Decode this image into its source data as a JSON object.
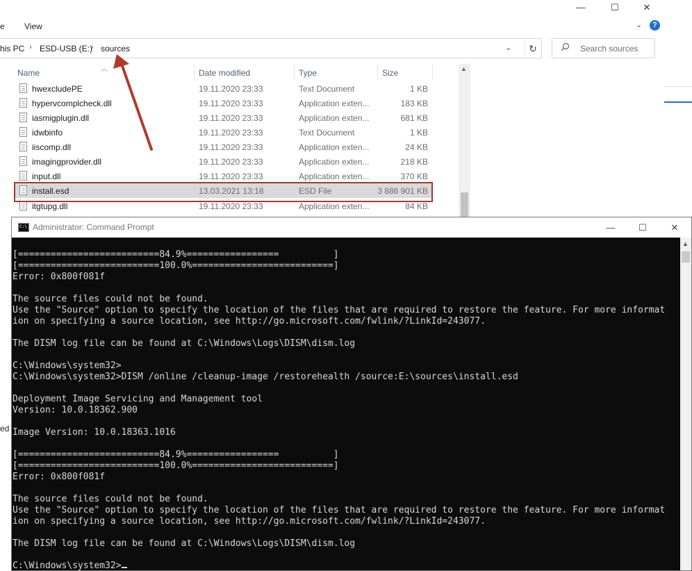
{
  "explorer": {
    "window_controls": {
      "minimize": "—",
      "maximize": "☐",
      "close": "✕"
    },
    "ribbon": {
      "left_tab_fragment": "e",
      "view_tab": "View",
      "expand_glyph": "⌄",
      "help_glyph": "?"
    },
    "address": {
      "crumbs": [
        "his PC",
        "ESD-USB (E:)",
        "sources"
      ],
      "separator": "›",
      "dropdown_glyph": "⌄",
      "refresh_glyph": "↻"
    },
    "search": {
      "placeholder": "Search sources",
      "icon": "search-icon"
    },
    "columns": {
      "name": "Name",
      "date": "Date modified",
      "type": "Type",
      "size": "Size"
    },
    "files": [
      {
        "name": "hwexcludePE",
        "date": "19.11.2020 23:33",
        "type": "Text Document",
        "size": "1 KB"
      },
      {
        "name": "hypervcomplcheck.dll",
        "date": "19.11.2020 23:33",
        "type": "Application exten...",
        "size": "183 KB"
      },
      {
        "name": "iasmigplugin.dll",
        "date": "19.11.2020 23:33",
        "type": "Application exten...",
        "size": "681 KB"
      },
      {
        "name": "idwbinfo",
        "date": "19.11.2020 23:33",
        "type": "Text Document",
        "size": "1 KB"
      },
      {
        "name": "iiscomp.dll",
        "date": "19.11.2020 23:33",
        "type": "Application exten...",
        "size": "24 KB"
      },
      {
        "name": "imagingprovider.dll",
        "date": "19.11.2020 23:33",
        "type": "Application exten...",
        "size": "218 KB"
      },
      {
        "name": "input.dll",
        "date": "19.11.2020 23:33",
        "type": "Application exten...",
        "size": "370 KB"
      },
      {
        "name": "install.esd",
        "date": "13.03.2021 13:18",
        "type": "ESD File",
        "size": "3 886 901 KB"
      },
      {
        "name": "itgtupg.dll",
        "date": "19.11.2020 23:33",
        "type": "Application exten...",
        "size": "84 KB"
      }
    ],
    "left_stub": "ed",
    "colors": {
      "highlight_border": "#a33a2e",
      "arrow": "#b23a2b",
      "accent": "#1c6fd1"
    }
  },
  "cmd": {
    "title": "Administrator: Command Prompt",
    "window_controls": {
      "minimize": "—",
      "maximize": "☐",
      "close": "✕"
    },
    "console_lines": [
      "[==========================84.9%=================          ]",
      "[==========================100.0%==========================]",
      "Error: 0x800f081f",
      "",
      "The source files could not be found.",
      "Use the \"Source\" option to specify the location of the files that are required to restore the feature. For more informat",
      "ion on specifying a source location, see http://go.microsoft.com/fwlink/?LinkId=243077.",
      "",
      "The DISM log file can be found at C:\\Windows\\Logs\\DISM\\dism.log",
      "",
      "C:\\Windows\\system32>",
      "C:\\Windows\\system32>DISM /online /cleanup-image /restorehealth /source:E:\\sources\\install.esd",
      "",
      "Deployment Image Servicing and Management tool",
      "Version: 10.0.18362.900",
      "",
      "Image Version: 10.0.18363.1016",
      "",
      "[==========================84.9%=================          ]",
      "[==========================100.0%==========================]",
      "Error: 0x800f081f",
      "",
      "The source files could not be found.",
      "Use the \"Source\" option to specify the location of the files that are required to restore the feature. For more informat",
      "ion on specifying a source location, see http://go.microsoft.com/fwlink/?LinkId=243077.",
      "",
      "The DISM log file can be found at C:\\Windows\\Logs\\DISM\\dism.log",
      "",
      "C:\\Windows\\system32>"
    ],
    "colors": {
      "background": "#0c0c0c",
      "text": "#d8d8d8"
    }
  }
}
